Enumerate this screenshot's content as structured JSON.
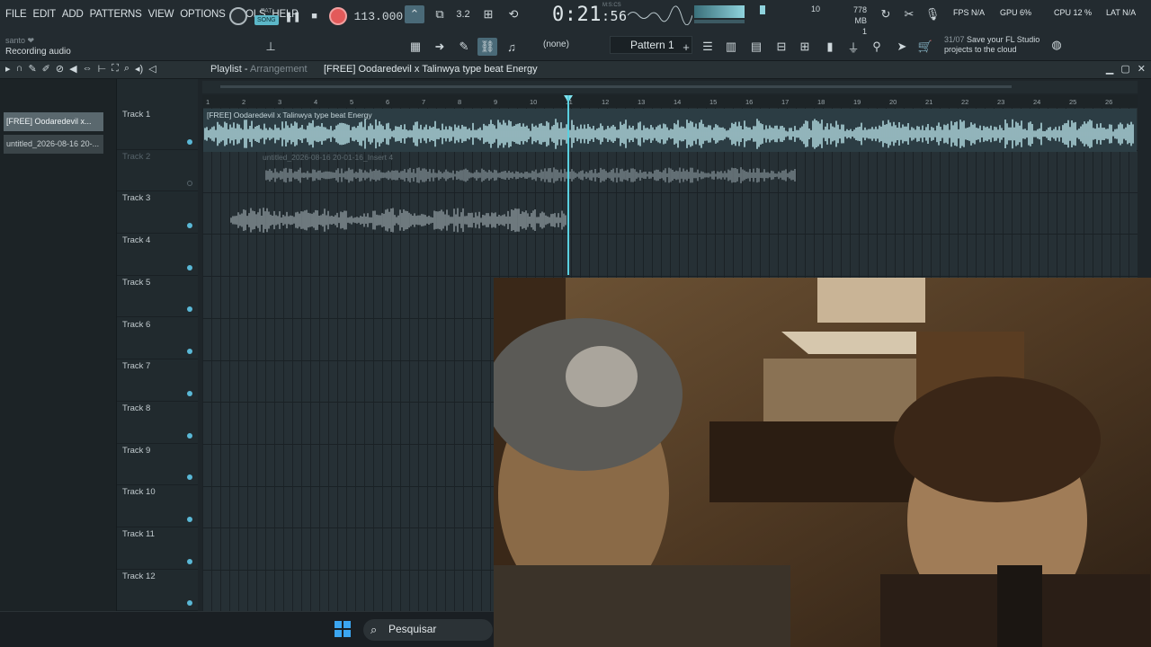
{
  "menu": [
    "FILE",
    "EDIT",
    "ADD",
    "PATTERNS",
    "VIEW",
    "OPTIONS",
    "TOOLS",
    "HELP"
  ],
  "user": "santo ❤",
  "status": "Recording audio",
  "transport": {
    "pat": "PAT",
    "song": "SONG",
    "tempo": "113.000"
  },
  "time": {
    "main": "0:21",
    "sub": ":56",
    "unit": "M:S:CS"
  },
  "counter": "10",
  "memory": {
    "mb": "778 MB",
    "n": "1"
  },
  "perf": {
    "fps": "FPS N/A",
    "gpu": "GPU 6%",
    "cpu": "CPU 12 %",
    "lat": "LAT N/A"
  },
  "channel": "(none)",
  "pattern": "Pattern 1",
  "news": {
    "date": "31/07",
    "text1": "Save your FL Studio",
    "text2": "projects to the cloud"
  },
  "playlist": {
    "title": "Playlist",
    "sub": "Arrangement",
    "project": "[FREE] Oodaredevil x Talinwya type beat  Energy"
  },
  "browser_clips": [
    "[FREE] Oodaredevil x...",
    "untitled_2026-08-16 20-..."
  ],
  "tracks": [
    "Track 1",
    "Track 2",
    "Track 3",
    "Track 4",
    "Track 5",
    "Track 6",
    "Track 7",
    "Track 8",
    "Track 9",
    "Track 10",
    "Track 11",
    "Track 12"
  ],
  "ruler": [
    "1",
    "2",
    "3",
    "4",
    "5",
    "6",
    "7",
    "8",
    "9",
    "10",
    "11",
    "12",
    "13",
    "14",
    "15",
    "16",
    "17",
    "18",
    "19",
    "20",
    "21",
    "22",
    "23",
    "24",
    "25",
    "26"
  ],
  "clips": {
    "main": "[FREE] Oodaredevil x Talinwya type beat  Energy",
    "insert": "untitled_2026-08-16 20-01-16_Insert 4"
  },
  "taskbar": {
    "search": "Pesquisar"
  },
  "colors": {
    "accent": "#5cb7c8",
    "record": "#e35a5a",
    "waveform": "#bde7ee",
    "background": "#1e2529"
  }
}
